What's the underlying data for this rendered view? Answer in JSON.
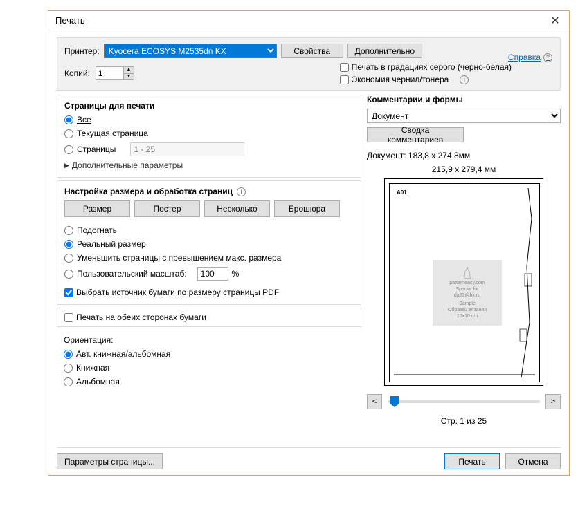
{
  "title": "Печать",
  "printer": {
    "label": "Принтер:",
    "selected": "Kyocera ECOSYS M2535dn KX",
    "properties": "Свойства",
    "advanced": "Дополнительно"
  },
  "help_link": "Справка",
  "copies": {
    "label": "Копий:",
    "value": "1"
  },
  "grayscale_label": "Печать в градациях серого (черно-белая)",
  "savetoner_label": "Экономия чернил/тонера",
  "pages_to_print": {
    "title": "Страницы для печати",
    "all": "Все",
    "current": "Текущая страница",
    "pages": "Страницы",
    "range_placeholder": "1 - 25",
    "more": "Дополнительные параметры"
  },
  "sizing": {
    "title": "Настройка размера и обработка страниц",
    "size": "Размер",
    "poster": "Постер",
    "multiple": "Несколько",
    "booklet": "Брошюра",
    "fit": "Подогнать",
    "actual": "Реальный размер",
    "shrink": "Уменьшить страницы с превышением макс. размера",
    "custom": "Пользовательский масштаб:",
    "custom_value": "100",
    "percent": "%",
    "choose_source": "Выбрать источник бумаги по размеру страницы PDF"
  },
  "duplex_label": "Печать на обеих сторонах бумаги",
  "orientation": {
    "title": "Ориентация:",
    "auto": "Авт. книжная/альбомная",
    "portrait": "Книжная",
    "landscape": "Альбомная"
  },
  "comments": {
    "title": "Комментарии и формы",
    "selected": "Документ",
    "summary": "Сводка комментариев"
  },
  "doc_size": "Документ: 183,8 x 274,8мм",
  "preview_size": "215,9 x 279,4 мм",
  "preview": {
    "label": "A01",
    "mark_line1": "patterneasy.com",
    "mark_line2": "Special for",
    "mark_line3": "da23@bk.ru",
    "mark_line4": "Sample",
    "mark_line5": "Образец вязания",
    "mark_line6": "10x10 cm"
  },
  "nav": {
    "prev": "<",
    "next": ">",
    "page": "Стр. 1 из 25"
  },
  "footer": {
    "page_setup": "Параметры страницы...",
    "print": "Печать",
    "cancel": "Отмена"
  }
}
